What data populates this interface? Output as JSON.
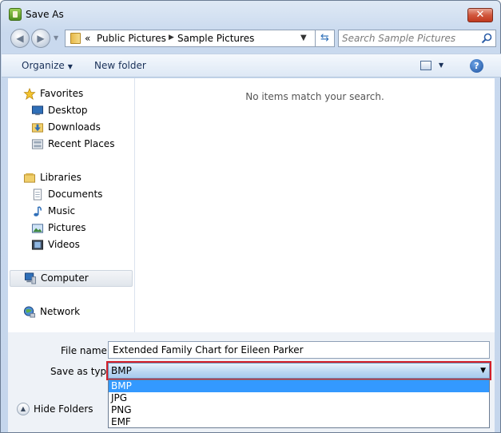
{
  "window": {
    "title": "Save As",
    "close_glyph": "✕"
  },
  "address": {
    "overflow": "«",
    "crumbs": [
      "Public Pictures",
      "Sample Pictures"
    ],
    "search_placeholder": "Search Sample Pictures"
  },
  "toolbar": {
    "organize": "Organize",
    "new_folder": "New folder"
  },
  "nav": {
    "favorites": "Favorites",
    "desktop": "Desktop",
    "downloads": "Downloads",
    "recent_places": "Recent Places",
    "libraries": "Libraries",
    "documents": "Documents",
    "music": "Music",
    "pictures": "Pictures",
    "videos": "Videos",
    "computer": "Computer",
    "network": "Network"
  },
  "main": {
    "empty_message": "No items match your search."
  },
  "form": {
    "file_name_label": "File name:",
    "file_name_value": "Extended Family Chart for Eileen Parker",
    "save_type_label": "Save as type:",
    "save_type_value": "BMP",
    "type_options": [
      "BMP",
      "JPG",
      "PNG",
      "EMF"
    ]
  },
  "footer": {
    "hide_folders": "Hide Folders"
  },
  "colors": {
    "highlight": "#d3202a",
    "selection": "#3399ff"
  }
}
